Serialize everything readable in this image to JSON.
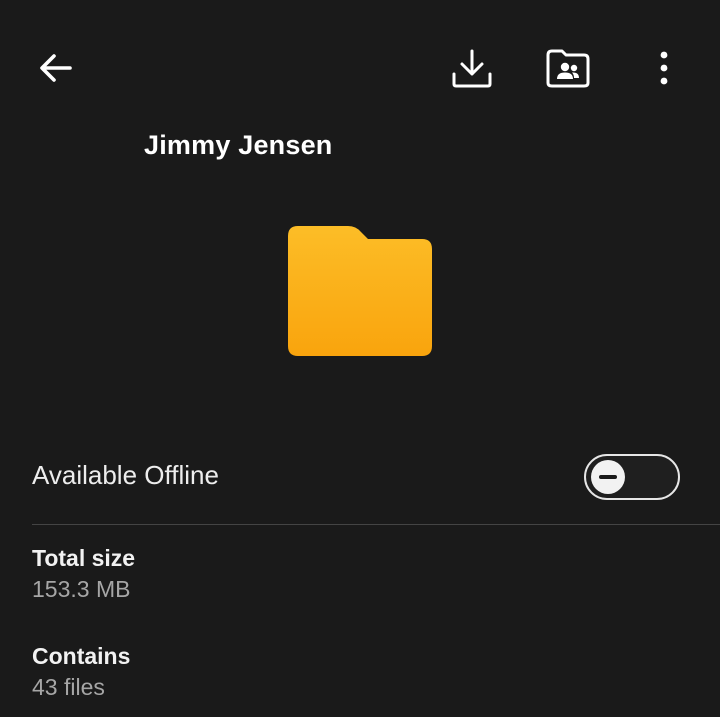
{
  "toolbar": {
    "back_icon": "arrow-left-icon",
    "download_icon": "download-icon",
    "shared_folder_icon": "shared-folder-icon",
    "more_icon": "more-vertical-icon"
  },
  "folder": {
    "title": "Jimmy Jensen",
    "icon": "folder-icon",
    "color": "#fbb117"
  },
  "offline": {
    "label": "Available Offline",
    "enabled": false
  },
  "details": {
    "total_size_label": "Total size",
    "total_size_value": "153.3 MB",
    "contains_label": "Contains",
    "contains_value": "43 files"
  }
}
